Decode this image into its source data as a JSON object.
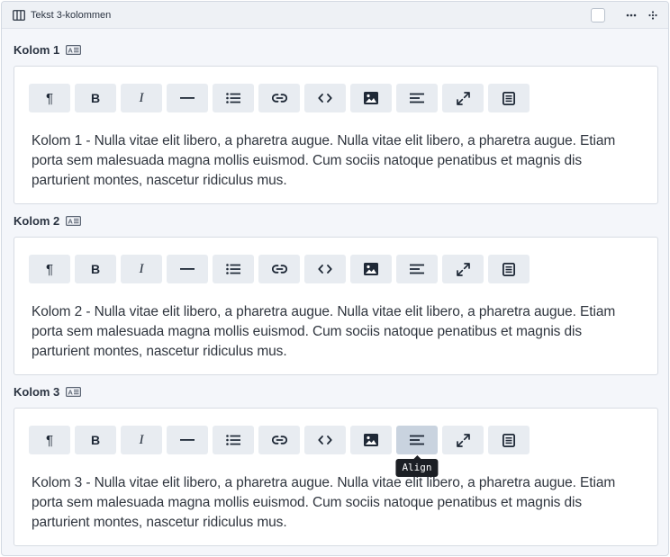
{
  "block": {
    "title": "Tekst 3-kolommen",
    "icons": [
      "columns-icon",
      "checkbox",
      "more-icon",
      "drag-handle-icon"
    ]
  },
  "toolbar": {
    "buttons": [
      {
        "name": "paragraph",
        "glyph": "¶"
      },
      {
        "name": "bold",
        "glyph": "B"
      },
      {
        "name": "italic",
        "glyph": "I"
      },
      {
        "name": "horizontal-rule"
      },
      {
        "name": "bullet-list"
      },
      {
        "name": "link"
      },
      {
        "name": "code"
      },
      {
        "name": "image"
      },
      {
        "name": "align"
      },
      {
        "name": "fullscreen"
      },
      {
        "name": "blocks"
      }
    ],
    "tooltip": "Align"
  },
  "fields": [
    {
      "label": "Kolom 1",
      "text": "Kolom 1 - Nulla vitae elit libero, a pharetra augue. Nulla vitae elit libero, a pharetra augue. Etiam porta sem malesuada magna mollis euismod. Cum sociis natoque penatibus et magnis dis parturient montes, nascetur ridiculus mus."
    },
    {
      "label": "Kolom 2",
      "text": "Kolom 2 - Nulla vitae elit libero, a pharetra augue. Nulla vitae elit libero, a pharetra augue. Etiam porta sem malesuada magna mollis euismod. Cum sociis natoque penatibus et magnis dis parturient montes, nascetur ridiculus mus."
    },
    {
      "label": "Kolom 3",
      "text": "Kolom 3 - Nulla vitae elit libero, a pharetra augue. Nulla vitae elit libero, a pharetra augue. Etiam porta sem malesuada magna mollis euismod. Cum sociis natoque penatibus et magnis dis parturient montes, nascetur ridiculus mus.",
      "active_button": "align"
    }
  ],
  "colors": {
    "panel_bg": "#f4f6fa",
    "button_bg": "#e8ecf1",
    "button_active_bg": "#c9d3df",
    "tooltip_bg": "#1c1f24"
  }
}
